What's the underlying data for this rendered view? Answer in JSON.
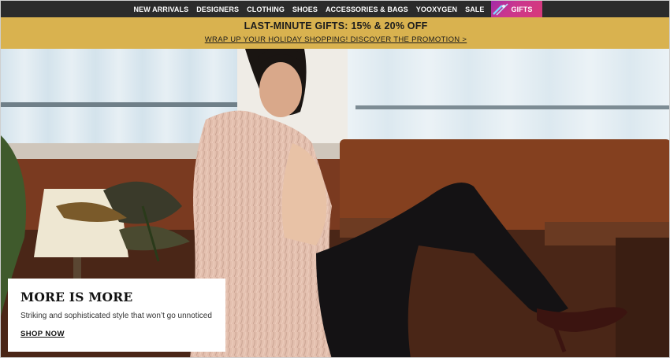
{
  "nav": {
    "items": [
      {
        "label": "NEW ARRIVALS"
      },
      {
        "label": "DESIGNERS"
      },
      {
        "label": "CLOTHING"
      },
      {
        "label": "SHOES"
      },
      {
        "label": "ACCESSORIES & BAGS"
      },
      {
        "label": "YOOXYGEN"
      },
      {
        "label": "SALE"
      }
    ],
    "gifts": {
      "label": "GIFTS",
      "icon": "gift-ribbon-icon"
    }
  },
  "promo": {
    "title": "LAST-MINUTE GIFTS: 15% & 20% OFF",
    "link": "WRAP UP YOUR HOLIDAY SHOPPING! DISCOVER THE PROMOTION >"
  },
  "hero": {
    "card": {
      "title": "MORE IS MORE",
      "description": "Striking and sophisticated style that won’t go unnoticed",
      "cta": "SHOP NOW"
    }
  },
  "colors": {
    "nav_bg": "#2b2b2b",
    "promo_bg": "#d9b24f",
    "gifts_accent": "#c9368f"
  }
}
